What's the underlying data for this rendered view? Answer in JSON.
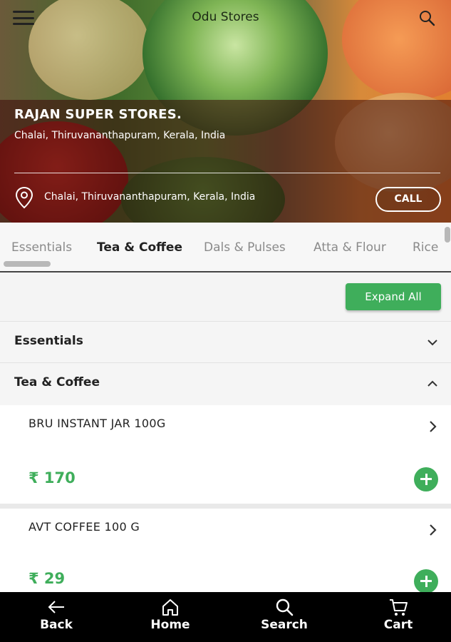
{
  "header": {
    "app_title": "Odu Stores",
    "store_name": "RAJAN SUPER STORES.",
    "store_address": "Chalai, Thiruvananthapuram, Kerala, India",
    "location_text": "Chalai, Thiruvananthapuram, Kerala, India",
    "call_label": "CALL"
  },
  "tabs": [
    "Essentials",
    "Tea & Coffee",
    "Dals & Pulses",
    "Atta & Flour",
    "Rice"
  ],
  "active_tab": "Tea & Coffee",
  "expand_all_label": "Expand All",
  "sections": [
    {
      "label": "Essentials",
      "expanded": false
    },
    {
      "label": "Tea & Coffee",
      "expanded": true
    }
  ],
  "products": [
    {
      "name": "BRU INSTANT JAR 100G",
      "price": "₹ 170"
    },
    {
      "name": "AVT COFFEE 100 G",
      "price": "₹ 29"
    }
  ],
  "bottom_nav": [
    {
      "label": "Back",
      "icon": "arrow-left-icon"
    },
    {
      "label": "Home",
      "icon": "home-icon"
    },
    {
      "label": "Search",
      "icon": "search-icon"
    },
    {
      "label": "Cart",
      "icon": "cart-icon"
    }
  ],
  "colors": {
    "accent": "#3fae5b",
    "nav_bg": "#000000"
  }
}
